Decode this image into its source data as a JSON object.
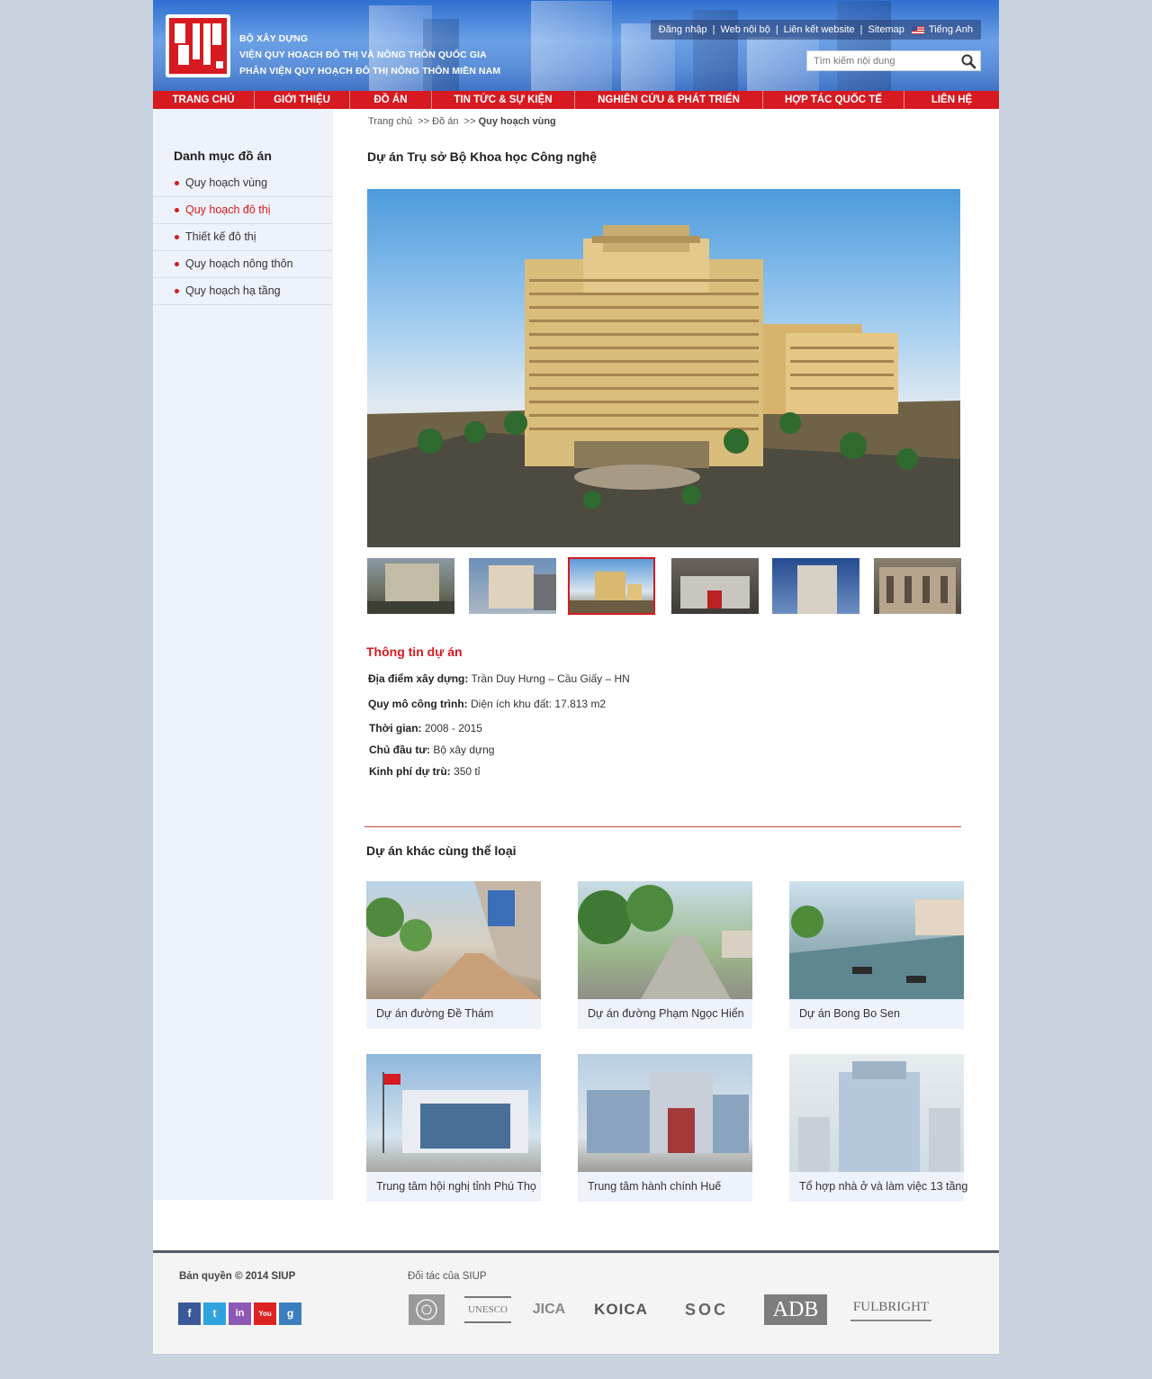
{
  "header": {
    "logo_text": "SIUP",
    "org_lines": [
      "BỘ XÂY DỰNG",
      "VIỆN QUY HOẠCH ĐÔ THỊ VÀ NÔNG THÔN QUỐC GIA",
      "PHÂN VIỆN QUY HOẠCH ĐÔ THỊ NÔNG THÔN MIỀN NAM"
    ],
    "top_links": [
      "Đăng nhập",
      "Web nội bộ",
      "Liên kết website",
      "Sitemap"
    ],
    "language": "Tiếng Anh",
    "search_placeholder": "Tìm kiếm nội dung"
  },
  "nav": [
    "TRANG CHỦ",
    "GIỚI THIỆU",
    "ĐỒ ÁN",
    "TIN TỨC & SỰ KIỆN",
    "NGHIÊN CỨU & PHÁT TRIỂN",
    "HỢP TÁC QUỐC TẾ",
    "LIÊN HỆ"
  ],
  "sidebar": {
    "title": "Danh mục đồ án",
    "items": [
      "Quy hoạch vùng",
      "Quy hoạch đô thị",
      "Thiết kế đô thị",
      "Quy hoạch nông thôn",
      "Quy hoạch hạ tầng"
    ],
    "active_index": 1
  },
  "breadcrumb": {
    "items": [
      "Trang chủ",
      "Đồ án"
    ],
    "separator": ">>",
    "current": "Quy hoạch vùng"
  },
  "project": {
    "title": "Dự án Trụ sở Bộ Khoa học Công nghệ",
    "selected_thumb": 2,
    "thumb_count": 6,
    "info_heading": "Thông tin dự án",
    "info": [
      {
        "label": "Địa điểm xây dựng:",
        "value": "Trần Duy Hưng – Cầu Giấy – HN"
      },
      {
        "label": "Quy mô công trình:",
        "value": "Diện ích khu đất: 17.813 m2"
      },
      {
        "label": "Thời gian:",
        "value": "2008 - 2015"
      },
      {
        "label": "Chủ đầu tư:",
        "value": "Bộ xây dựng"
      },
      {
        "label": "Kinh phí dự trù:",
        "value": "350 tỉ"
      }
    ]
  },
  "related": {
    "heading": "Dự án khác cùng thể loại",
    "items": [
      "Dự án đường Đề Thám",
      "Dự án đường Phạm Ngọc Hiển",
      "Dự án Bong Bo Sen",
      "Trung tâm hội nghị tỉnh Phú Thọ",
      "Trung tâm hành chính Huế",
      "Tổ hợp nhà ở và làm việc 13 tầng"
    ]
  },
  "footer": {
    "copyright": "Bản quyền © 2014 SIUP",
    "social": [
      "f",
      "t",
      "in",
      "You",
      "g"
    ],
    "partners_heading": "Đối tác của SIUP",
    "partners": [
      "UN",
      "UNESCO",
      "JICA",
      "KOICA",
      "SOC",
      "ADB",
      "FULBRIGHT"
    ]
  },
  "colors": {
    "accent": "#d71920",
    "sidebar_bg": "#eef2fb",
    "header_blue": "#4f86d8"
  }
}
